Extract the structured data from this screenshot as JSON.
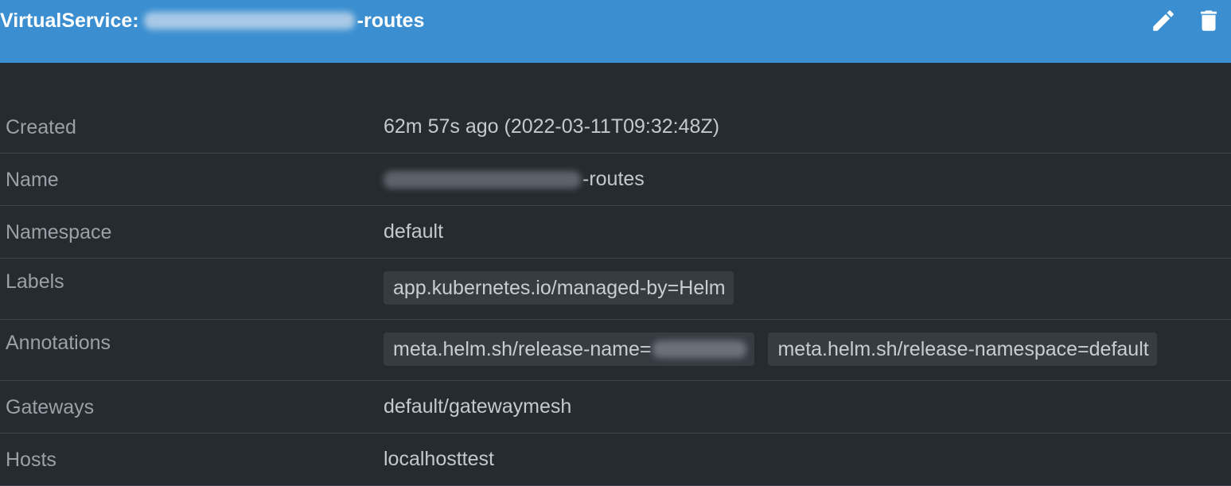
{
  "header": {
    "title_prefix": "VirtualService:",
    "title_suffix": "-routes",
    "actions": [
      {
        "name": "edit",
        "icon": "pencil-icon"
      },
      {
        "name": "delete",
        "icon": "trash-icon"
      }
    ],
    "background_color": "#3b8fd0"
  },
  "details": {
    "created": {
      "label": "Created",
      "value": "62m 57s ago (2022-03-11T09:32:48Z)"
    },
    "name": {
      "label": "Name",
      "value_suffix": "-routes"
    },
    "namespace": {
      "label": "Namespace",
      "value": "default"
    },
    "labels": {
      "label": "Labels",
      "chips": [
        "app.kubernetes.io/managed-by=Helm"
      ]
    },
    "annotations": {
      "label": "Annotations",
      "chips": [
        "meta.helm.sh/release-name=",
        "meta.helm.sh/release-namespace=default"
      ]
    },
    "gateways": {
      "label": "Gateways",
      "value": "default/gatewaymesh"
    },
    "hosts": {
      "label": "Hosts",
      "value": "localhosttest"
    }
  },
  "theme": {
    "background": "#262b30",
    "divider": "#3d444b",
    "chip_background": "#363c42"
  }
}
